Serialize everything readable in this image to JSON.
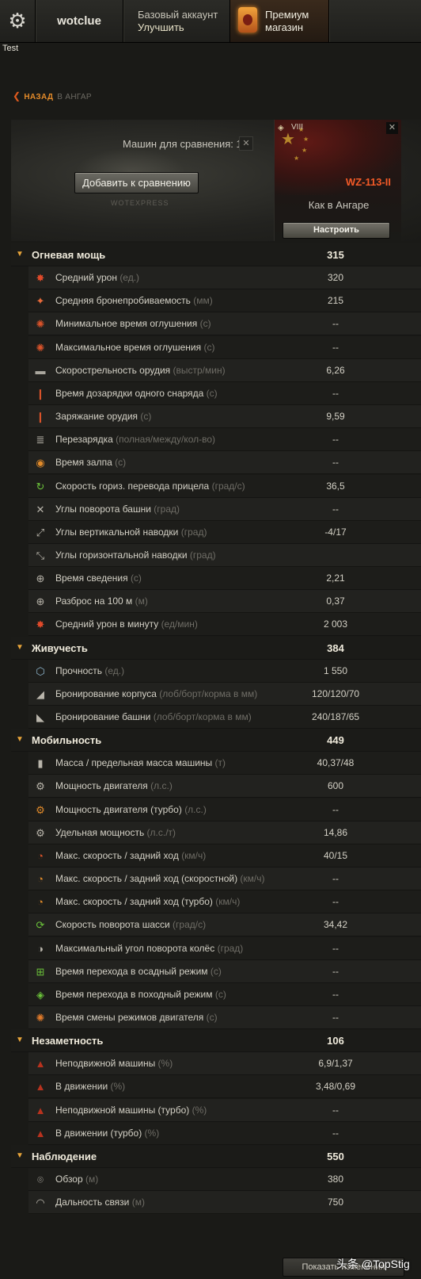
{
  "topbar": {
    "username": "wotclue",
    "account": {
      "line1": "Базовый аккаунт",
      "line2": "Улучшить"
    },
    "premium": {
      "line1": "Премиум",
      "line2": "магазин"
    },
    "test_label": "Test"
  },
  "nav": {
    "back_label": "НАЗАД",
    "back_target": "В АНГАР"
  },
  "compare": {
    "count_label": "Машин для сравнения: 1",
    "add_button": "Добавить к сравнению",
    "watermark": "WOTEXPRESS"
  },
  "tank": {
    "tier": "VIII",
    "name": "WZ-113-II",
    "config_label": "Как в Ангаре",
    "config_button": "Настроить"
  },
  "rows": [
    {
      "type": "cat",
      "label": "Огневая мощь",
      "value": "315"
    },
    {
      "type": "stat",
      "icon": "damage-icon",
      "label": "Средний урон",
      "unit": "(ед.)",
      "value": "320"
    },
    {
      "type": "stat",
      "icon": "penetration-icon",
      "label": "Средняя бронепробиваемость",
      "unit": "(мм)",
      "value": "215"
    },
    {
      "type": "stat",
      "icon": "stun-min-icon",
      "label": "Минимальное время оглушения",
      "unit": "(с)",
      "value": "--"
    },
    {
      "type": "stat",
      "icon": "stun-max-icon",
      "label": "Максимальное время оглушения",
      "unit": "(с)",
      "value": "--"
    },
    {
      "type": "stat",
      "icon": "rate-of-fire-icon",
      "label": "Скорострельность орудия",
      "unit": "(выстр/мин)",
      "value": "6,26"
    },
    {
      "type": "stat",
      "icon": "shell-reload-icon",
      "label": "Время дозарядки одного снаряда",
      "unit": "(с)",
      "value": "--"
    },
    {
      "type": "stat",
      "icon": "reload-icon",
      "label": "Заряжание орудия",
      "unit": "(с)",
      "value": "9,59"
    },
    {
      "type": "stat",
      "icon": "magazine-icon",
      "label": "Перезарядка",
      "unit": "(полная/между/кол-во)",
      "value": "--"
    },
    {
      "type": "stat",
      "icon": "salvo-icon",
      "label": "Время залпа",
      "unit": "(с)",
      "value": "--"
    },
    {
      "type": "stat",
      "icon": "aim-traverse-icon",
      "label": "Скорость гориз. перевода прицела",
      "unit": "(град/с)",
      "value": "36,5"
    },
    {
      "type": "stat",
      "icon": "turret-angle-icon",
      "label": "Углы поворота башни",
      "unit": "(град)",
      "value": "--"
    },
    {
      "type": "stat",
      "icon": "elevation-icon",
      "label": "Углы вертикальной наводки",
      "unit": "(град)",
      "value": "-4/17"
    },
    {
      "type": "stat",
      "icon": "horizontal-aim-icon",
      "label": "Углы горизонтальной наводки",
      "unit": "(град)",
      "value": ""
    },
    {
      "type": "stat",
      "icon": "aim-time-icon",
      "label": "Время сведения",
      "unit": "(с)",
      "value": "2,21"
    },
    {
      "type": "stat",
      "icon": "dispersion-icon",
      "label": "Разброс на 100 м",
      "unit": "(м)",
      "value": "0,37"
    },
    {
      "type": "stat",
      "icon": "dpm-icon",
      "label": "Средний урон в минуту",
      "unit": "(ед/мин)",
      "value": "2 003"
    },
    {
      "type": "cat",
      "label": "Живучесть",
      "value": "384"
    },
    {
      "type": "stat",
      "icon": "hitpoints-icon",
      "label": "Прочность",
      "unit": "(ед.)",
      "value": "1 550"
    },
    {
      "type": "stat",
      "icon": "hull-armor-icon",
      "label": "Бронирование корпуса",
      "unit": "(лоб/борт/корма в мм)",
      "value": "120/120/70"
    },
    {
      "type": "stat",
      "icon": "turret-armor-icon",
      "label": "Бронирование башни",
      "unit": "(лоб/борт/корма в мм)",
      "value": "240/187/65"
    },
    {
      "type": "cat",
      "label": "Мобильность",
      "value": "449"
    },
    {
      "type": "stat",
      "icon": "weight-icon",
      "label": "Масса / предельная масса машины",
      "unit": "(т)",
      "value": "40,37/48"
    },
    {
      "type": "stat",
      "icon": "engine-icon",
      "label": "Мощность двигателя",
      "unit": "(л.с.)",
      "value": "600"
    },
    {
      "type": "stat",
      "icon": "engine-turbo-icon",
      "label": "Мощность двигателя (турбо)",
      "unit": "(л.с.)",
      "value": "--"
    },
    {
      "type": "stat",
      "icon": "specific-power-icon",
      "label": "Удельная мощность",
      "unit": "(л.с./т)",
      "value": "14,86"
    },
    {
      "type": "stat",
      "icon": "speed-icon",
      "label": "Макс. скорость / задний ход",
      "unit": "(км/ч)",
      "value": "40/15"
    },
    {
      "type": "stat",
      "icon": "speed-fast-icon",
      "label": "Макс. скорость / задний ход (скоростной)",
      "unit": "(км/ч)",
      "value": "--"
    },
    {
      "type": "stat",
      "icon": "speed-turbo-icon",
      "label": "Макс. скорость / задний ход (турбо)",
      "unit": "(км/ч)",
      "value": "--"
    },
    {
      "type": "stat",
      "icon": "traverse-icon",
      "label": "Скорость поворота шасси",
      "unit": "(град/с)",
      "value": "34,42"
    },
    {
      "type": "stat",
      "icon": "wheel-angle-icon",
      "label": "Максимальный угол поворота колёс",
      "unit": "(град)",
      "value": "--"
    },
    {
      "type": "stat",
      "icon": "siege-mode-icon",
      "label": "Время перехода в осадный режим ",
      "unit": "(с)",
      "value": "--"
    },
    {
      "type": "stat",
      "icon": "travel-mode-icon",
      "label": "Время перехода в походный режим ",
      "unit": "(с)",
      "value": "--"
    },
    {
      "type": "stat",
      "icon": "engine-mode-icon",
      "label": "Время смены режимов двигателя",
      "unit": "(с)",
      "value": "--"
    },
    {
      "type": "cat",
      "label": "Незаметность",
      "value": "106"
    },
    {
      "type": "stat",
      "icon": "camo-still-icon",
      "label": "Неподвижной машины",
      "unit": "(%)",
      "value": "6,9/1,37"
    },
    {
      "type": "stat",
      "icon": "camo-moving-icon",
      "label": "В движении",
      "unit": "(%)",
      "value": "3,48/0,69"
    },
    {
      "type": "stat",
      "icon": "camo-still-turbo-icon",
      "label": "Неподвижной машины (турбо)",
      "unit": "(%)",
      "value": "--"
    },
    {
      "type": "stat",
      "icon": "camo-moving-turbo-icon",
      "label": "В движении (турбо)",
      "unit": "(%)",
      "value": "--"
    },
    {
      "type": "cat",
      "label": "Наблюдение",
      "value": "550"
    },
    {
      "type": "stat",
      "icon": "view-range-icon",
      "label": "Обзор",
      "unit": "(м)",
      "value": "380"
    },
    {
      "type": "stat",
      "icon": "radio-range-icon",
      "label": "Дальность связи",
      "unit": "(м)",
      "value": "750"
    }
  ],
  "footer": {
    "button_label": "Показать изменения",
    "watermark": "头条 @TopStig"
  }
}
